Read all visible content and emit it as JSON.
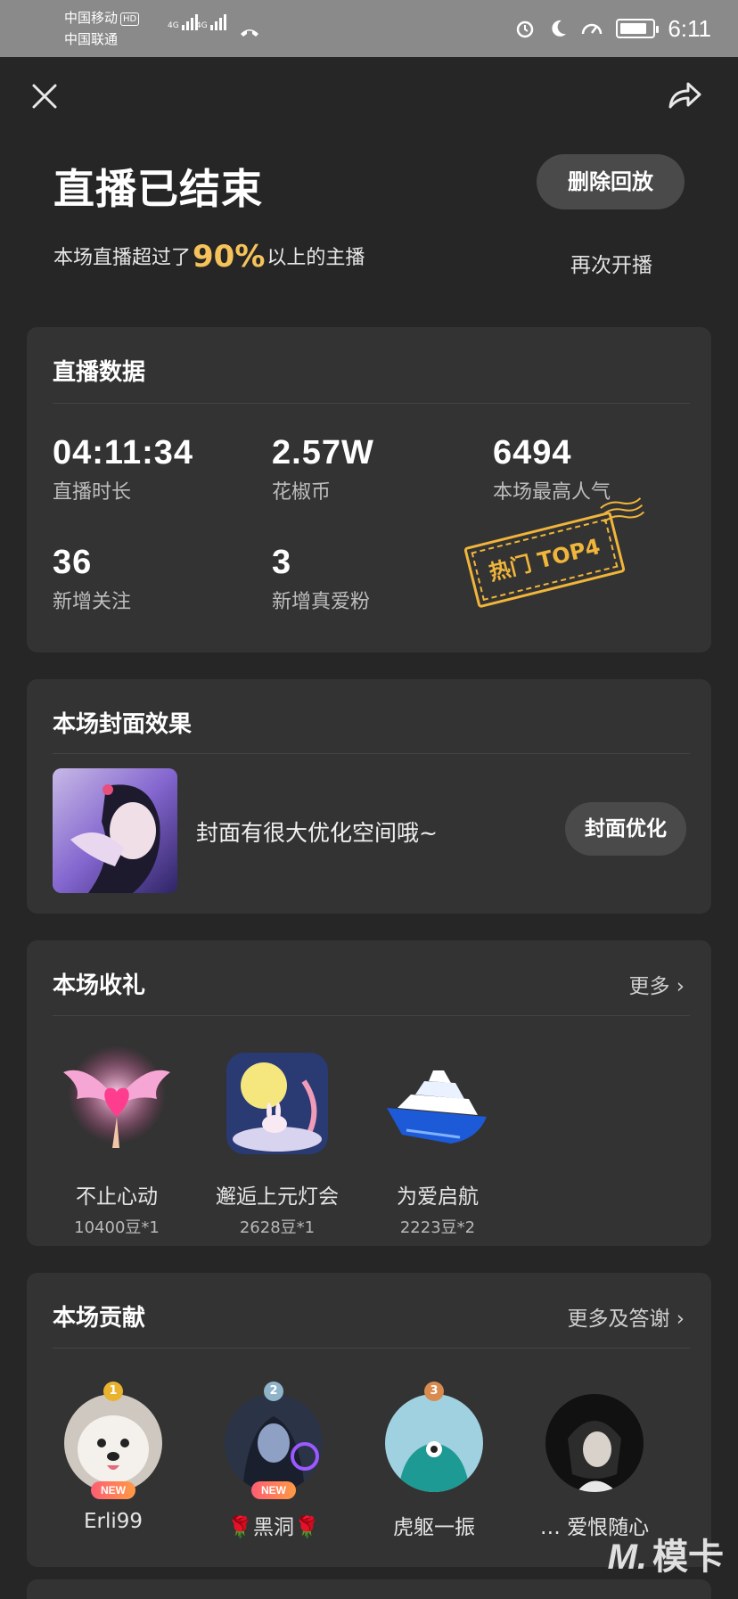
{
  "status_bar": {
    "carrier1": "中国移动",
    "carrier1_badge": "HD",
    "carrier2": "中国联通",
    "network1": "4G",
    "network2": "4G",
    "time": "6:11",
    "battery_level": 0.85
  },
  "header": {
    "title": "直播已结束",
    "subtitle_prefix": "本场直播超过了",
    "subtitle_percent": "90%",
    "subtitle_suffix": "以上的主播",
    "delete_button": "删除回放",
    "restart_link": "再次开播"
  },
  "live_data": {
    "title": "直播数据",
    "stats": [
      {
        "value": "04:11:34",
        "label": "直播时长"
      },
      {
        "value": "2.57W",
        "label": "花椒币"
      },
      {
        "value": "6494",
        "label": "本场最高人气"
      },
      {
        "value": "36",
        "label": "新增关注"
      },
      {
        "value": "3",
        "label": "新增真爱粉"
      }
    ],
    "stamp": "热门 TOP4"
  },
  "cover": {
    "title": "本场封面效果",
    "message": "封面有很大优化空间哦~",
    "button": "封面优化"
  },
  "gifts": {
    "title": "本场收礼",
    "more": "更多",
    "items": [
      {
        "name": "不止心动",
        "count": "10400豆*1",
        "icon": "winged-heart-icon"
      },
      {
        "name": "邂逅上元灯会",
        "count": "2628豆*1",
        "icon": "moon-rabbit-icon"
      },
      {
        "name": "为爱启航",
        "count": "2223豆*2",
        "icon": "yacht-icon"
      }
    ]
  },
  "contribution": {
    "title": "本场贡献",
    "more": "更多及答谢",
    "items": [
      {
        "rank": "1",
        "name": "Erli99",
        "badge": "NEW",
        "rank_color": "#e9b22f"
      },
      {
        "rank": "2",
        "name": "🌹黑洞🌹",
        "badge": "NEW",
        "rank_color": "#8fb3c9"
      },
      {
        "rank": "3",
        "name": "虎躯一振",
        "badge": "",
        "rank_color": "#d98a4e"
      },
      {
        "rank": "",
        "name": "… 爱恨随心",
        "badge": "",
        "rank_color": ""
      }
    ]
  },
  "watermark": "模卡",
  "colors": {
    "background": "#262626",
    "card": "#333333",
    "accent_gold": "#f6c35b",
    "stamp": "#f0b53a"
  }
}
